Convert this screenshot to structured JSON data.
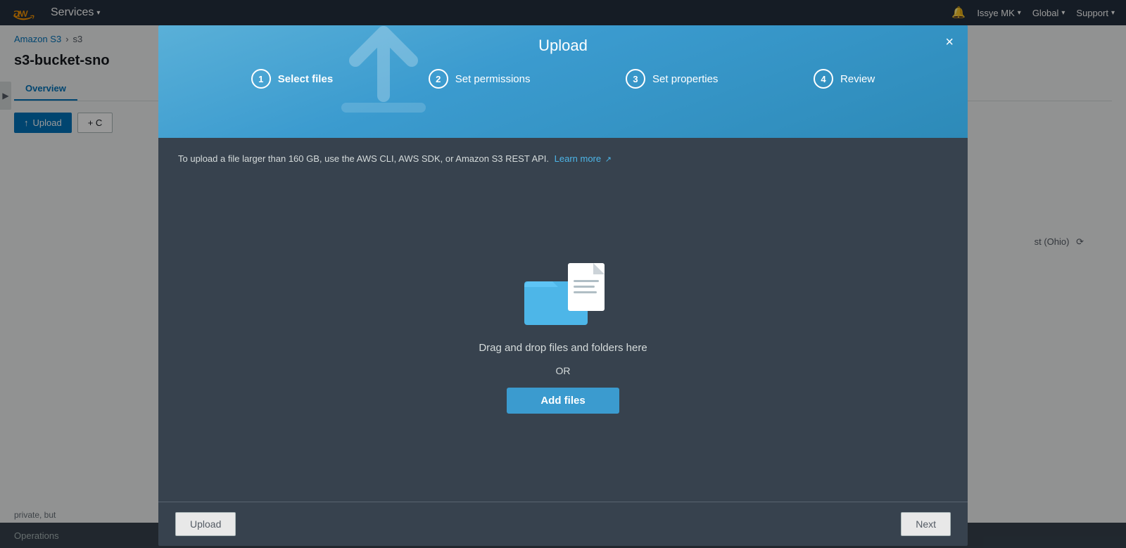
{
  "topnav": {
    "services_label": "Services",
    "bell_icon": "bell",
    "user": "Issye MK",
    "region": "Global",
    "support": "Support"
  },
  "background": {
    "breadcrumb_s3": "Amazon S3",
    "breadcrumb_arrow": "›",
    "breadcrumb_bucket": "s3",
    "bucket_title": "s3-bucket-sno",
    "tab_overview": "Overview",
    "btn_upload": "Upload",
    "btn_create_folder": "+ C",
    "region_label": "st (Ohio)",
    "footer_text": "private, but"
  },
  "modal": {
    "title": "Upload",
    "close_label": "×",
    "steps": [
      {
        "number": "1",
        "label": "Select files",
        "active": true
      },
      {
        "number": "2",
        "label": "Set permissions",
        "active": false
      },
      {
        "number": "3",
        "label": "Set properties",
        "active": false
      },
      {
        "number": "4",
        "label": "Review",
        "active": false
      }
    ],
    "info_text": "To upload a file larger than 160 GB, use the AWS CLI, AWS SDK, or Amazon S3 REST API.",
    "learn_more": "Learn more",
    "drag_text": "Drag and drop files and folders here",
    "or_text": "OR",
    "add_files_btn": "Add files",
    "footer_upload_btn": "Upload",
    "footer_next_btn": "Next"
  },
  "colors": {
    "header_bg": "#3b9bcf",
    "modal_body_bg": "#37424e",
    "accent_blue": "#3b9bcf",
    "text_light": "#d5dbdb",
    "nav_bg": "#232f3e"
  }
}
